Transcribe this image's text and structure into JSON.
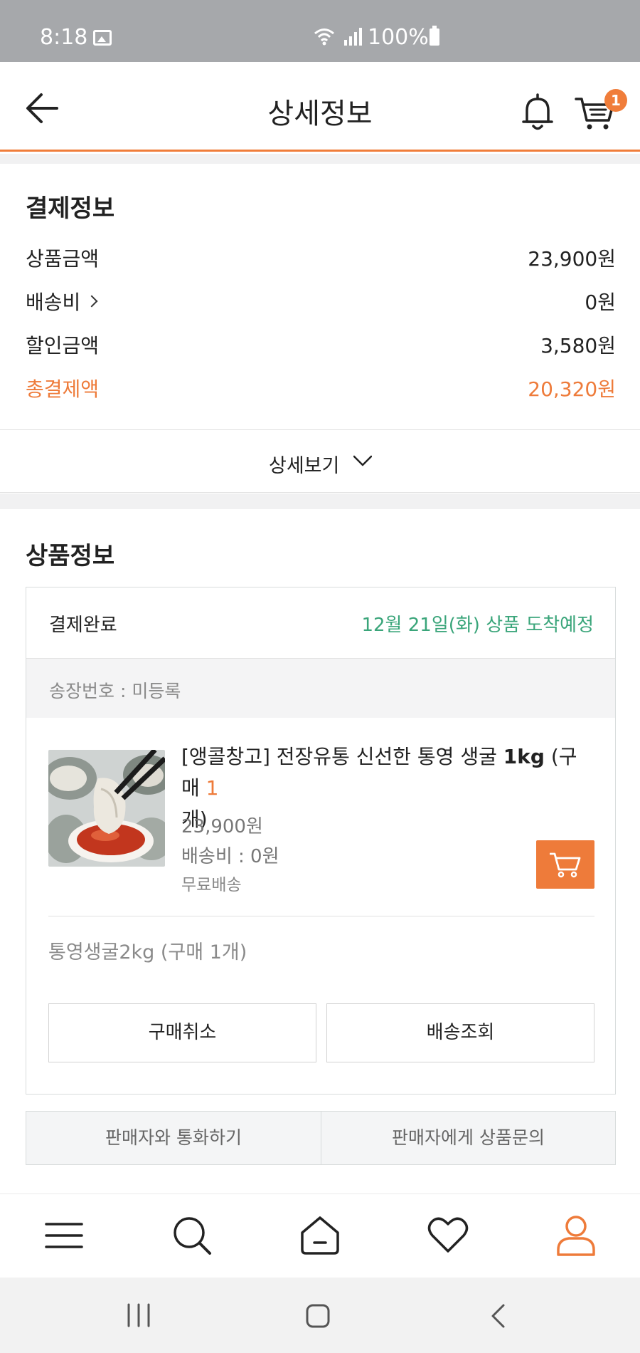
{
  "status_bar": {
    "time": "8:18",
    "battery": "100%"
  },
  "header": {
    "title": "상세정보",
    "cart_count": "1"
  },
  "payment": {
    "title": "결제정보",
    "rows": [
      {
        "label": "상품금액",
        "value": "23,900원"
      },
      {
        "label": "배송비",
        "value": "0원"
      },
      {
        "label": "할인금액",
        "value": "3,580원"
      },
      {
        "label": "총결제액",
        "value": "20,320원"
      }
    ],
    "detail_label": "상세보기"
  },
  "product_section": {
    "title": "상품정보",
    "order_status": "결제완료",
    "eta": "12월 21일(화) 상품 도착예정",
    "invoice": "송장번호 : 미등록",
    "item": {
      "name_before": "[앵콜창고] 전장유통 신선한 통영 생굴 ",
      "name_weight": "1kg",
      "name_purchase": " (구매 ",
      "name_qty": "1",
      "name_unit": "개)",
      "price": "23,900원",
      "shipping": "배송비 : 0원",
      "shipping_type": "무료배송"
    },
    "option": "통영생굴2kg (구매 1개)",
    "cancel_label": "구매취소",
    "track_label": "배송조회"
  },
  "seller": {
    "call_label": "판매자와 통화하기",
    "inquiry_label": "판매자에게 상품문의"
  },
  "colors": {
    "accent": "#ee7b3a",
    "eta": "#3aa57a"
  }
}
